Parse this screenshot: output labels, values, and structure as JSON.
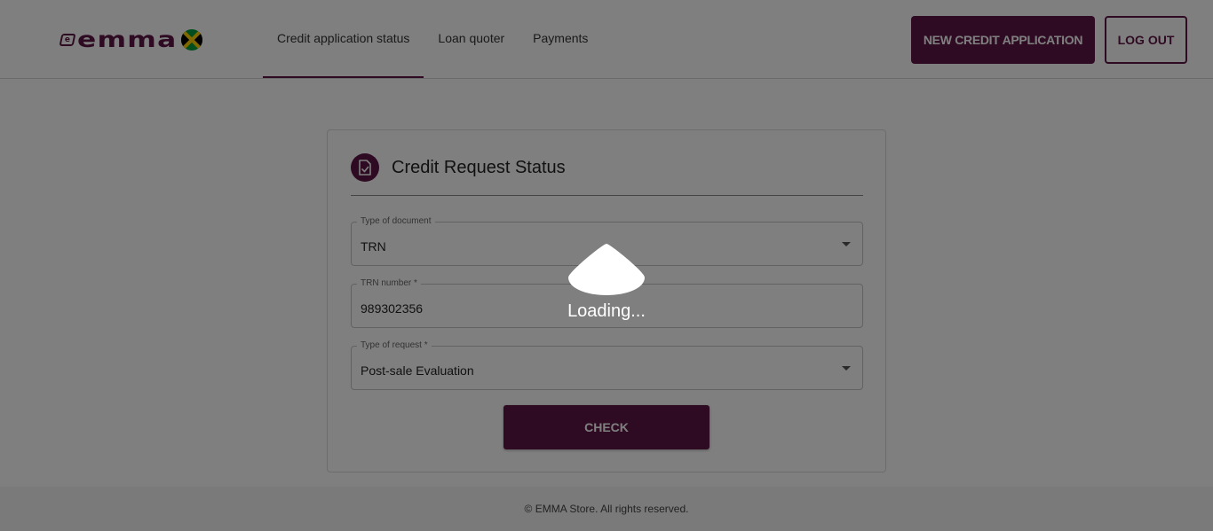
{
  "header": {
    "logo_text": "emma",
    "logo_mark": "e",
    "flag": "jamaica-flag",
    "nav": [
      {
        "label": "Credit application status",
        "active": true
      },
      {
        "label": "Loan quoter",
        "active": false
      },
      {
        "label": "Payments",
        "active": false
      }
    ],
    "new_application_label": "NEW CREDIT APPLICATION",
    "logout_label": "LOG OUT"
  },
  "card": {
    "icon": "document-check-icon",
    "title": "Credit Request Status",
    "fields": {
      "document_type": {
        "label": "Type of document",
        "value": "TRN"
      },
      "trn_number": {
        "label": "TRN number *",
        "value": "989302356"
      },
      "request_type": {
        "label": "Type of request *",
        "value": "Post-sale Evaluation"
      }
    },
    "check_label": "CHECK"
  },
  "footer": {
    "text": "© EMMA Store. All rights reserved."
  },
  "overlay": {
    "loading_text": "Loading..."
  },
  "colors": {
    "brand": "#5e1646",
    "overlay": "rgba(0,0,0,0.5)"
  }
}
